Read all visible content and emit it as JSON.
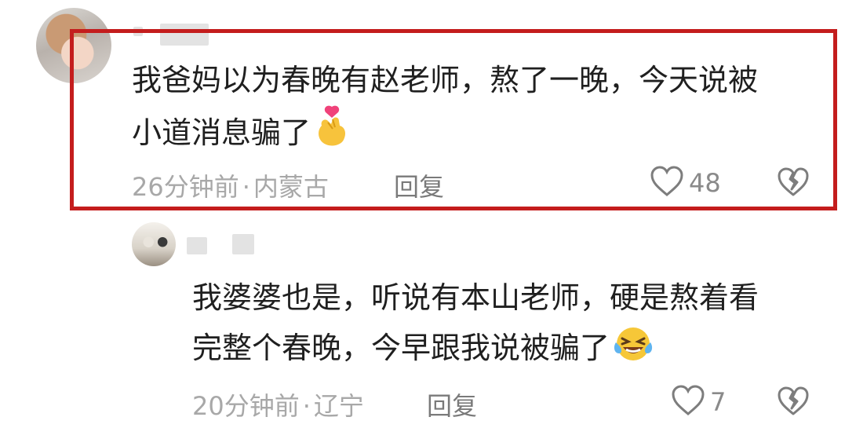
{
  "comments": [
    {
      "text_line1": "我爸妈以为春晚有赵老师，熬了一晚，今天说被",
      "text_line2": "小道消息骗了",
      "emoji": "finger-heart-emoji",
      "time": "26分钟前",
      "location": "内蒙古",
      "reply_label": "回复",
      "likes": "48"
    },
    {
      "text_line1": "我婆婆也是，听说有本山老师，硬是熬着看",
      "text_line2": "完整个春晚，今早跟我说被骗了",
      "emoji": "laughing-tears-emoji",
      "time": "20分钟前",
      "location": "辽宁",
      "reply_label": "回复",
      "likes": "7"
    }
  ],
  "separator": "·",
  "colors": {
    "highlight": "#c41d1d",
    "text": "#1f1f1f",
    "meta": "#a8a8a8"
  }
}
